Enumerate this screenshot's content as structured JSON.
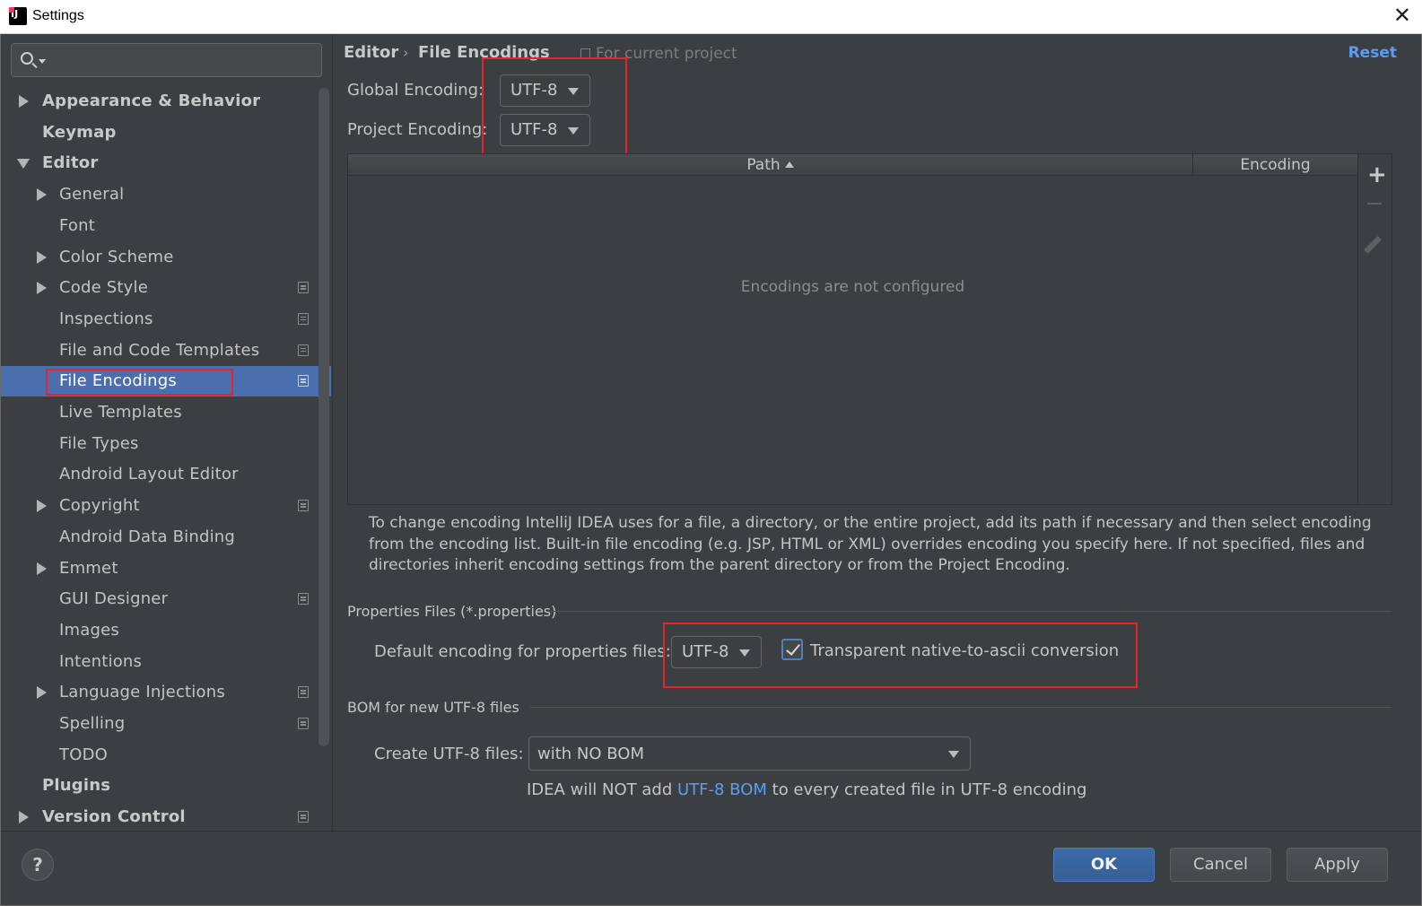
{
  "window": {
    "title": "Settings",
    "close_glyph": "✕"
  },
  "search": {
    "value": "",
    "placeholder": ""
  },
  "tree": [
    {
      "label": "Appearance & Behavior",
      "arrow": "right",
      "bold": true,
      "indent": 0,
      "project": false,
      "selected": false
    },
    {
      "label": "Keymap",
      "arrow": "none",
      "bold": true,
      "indent": 0,
      "project": false,
      "selected": false
    },
    {
      "label": "Editor",
      "arrow": "down",
      "bold": true,
      "indent": 0,
      "project": false,
      "selected": false
    },
    {
      "label": "General",
      "arrow": "right",
      "bold": false,
      "indent": 1,
      "project": false,
      "selected": false
    },
    {
      "label": "Font",
      "arrow": "none",
      "bold": false,
      "indent": 1,
      "project": false,
      "selected": false
    },
    {
      "label": "Color Scheme",
      "arrow": "right",
      "bold": false,
      "indent": 1,
      "project": false,
      "selected": false
    },
    {
      "label": "Code Style",
      "arrow": "right",
      "bold": false,
      "indent": 1,
      "project": true,
      "selected": false
    },
    {
      "label": "Inspections",
      "arrow": "none",
      "bold": false,
      "indent": 1,
      "project": true,
      "selected": false
    },
    {
      "label": "File and Code Templates",
      "arrow": "none",
      "bold": false,
      "indent": 1,
      "project": true,
      "selected": false
    },
    {
      "label": "File Encodings",
      "arrow": "none",
      "bold": false,
      "indent": 1,
      "project": true,
      "selected": true
    },
    {
      "label": "Live Templates",
      "arrow": "none",
      "bold": false,
      "indent": 1,
      "project": false,
      "selected": false
    },
    {
      "label": "File Types",
      "arrow": "none",
      "bold": false,
      "indent": 1,
      "project": false,
      "selected": false
    },
    {
      "label": "Android Layout Editor",
      "arrow": "none",
      "bold": false,
      "indent": 1,
      "project": false,
      "selected": false
    },
    {
      "label": "Copyright",
      "arrow": "right",
      "bold": false,
      "indent": 1,
      "project": true,
      "selected": false
    },
    {
      "label": "Android Data Binding",
      "arrow": "none",
      "bold": false,
      "indent": 1,
      "project": false,
      "selected": false
    },
    {
      "label": "Emmet",
      "arrow": "right",
      "bold": false,
      "indent": 1,
      "project": false,
      "selected": false
    },
    {
      "label": "GUI Designer",
      "arrow": "none",
      "bold": false,
      "indent": 1,
      "project": true,
      "selected": false
    },
    {
      "label": "Images",
      "arrow": "none",
      "bold": false,
      "indent": 1,
      "project": false,
      "selected": false
    },
    {
      "label": "Intentions",
      "arrow": "none",
      "bold": false,
      "indent": 1,
      "project": false,
      "selected": false
    },
    {
      "label": "Language Injections",
      "arrow": "right",
      "bold": false,
      "indent": 1,
      "project": true,
      "selected": false
    },
    {
      "label": "Spelling",
      "arrow": "none",
      "bold": false,
      "indent": 1,
      "project": true,
      "selected": false
    },
    {
      "label": "TODO",
      "arrow": "none",
      "bold": false,
      "indent": 1,
      "project": false,
      "selected": false
    },
    {
      "label": "Plugins",
      "arrow": "none",
      "bold": true,
      "indent": 0,
      "project": false,
      "selected": false
    },
    {
      "label": "Version Control",
      "arrow": "right",
      "bold": true,
      "indent": 0,
      "project": true,
      "selected": false
    }
  ],
  "header": {
    "crumb_parent": "Editor",
    "crumb_sep": "›",
    "crumb_current": "File Encodings",
    "scope_note": "For current project",
    "reset_label": "Reset"
  },
  "global_encoding": {
    "label": "Global Encoding:",
    "value": "UTF-8"
  },
  "project_encoding": {
    "label": "Project Encoding:",
    "value": "UTF-8"
  },
  "table": {
    "col_path": "Path",
    "col_encoding": "Encoding",
    "empty_text": "Encodings are not configured",
    "rows": []
  },
  "help_text": "To change encoding IntelliJ IDEA uses for a file, a directory, or the entire project, add its path if necessary and then select encoding from the encoding list. Built-in file encoding (e.g. JSP, HTML or XML) overrides encoding you specify here. If not specified, files and directories inherit encoding settings from the parent directory or from the Project Encoding.",
  "properties": {
    "section_title": "Properties Files (*.properties)",
    "default_label": "Default encoding for properties files:",
    "default_value": "UTF-8",
    "transparent_label": "Transparent native-to-ascii conversion",
    "transparent_checked": true
  },
  "bom": {
    "section_title": "BOM for new UTF-8 files",
    "create_label": "Create UTF-8 files:",
    "create_value": "with NO BOM",
    "note_prefix": "IDEA will NOT add ",
    "note_link": "UTF-8 BOM",
    "note_suffix": " to every created file in UTF-8 encoding"
  },
  "buttons": {
    "help": "?",
    "ok": "OK",
    "cancel": "Cancel",
    "apply": "Apply"
  },
  "colors": {
    "background": "#3c3f41",
    "selection": "#4b6eaf",
    "link": "#589df6",
    "annotation_box": "#e3262b"
  }
}
